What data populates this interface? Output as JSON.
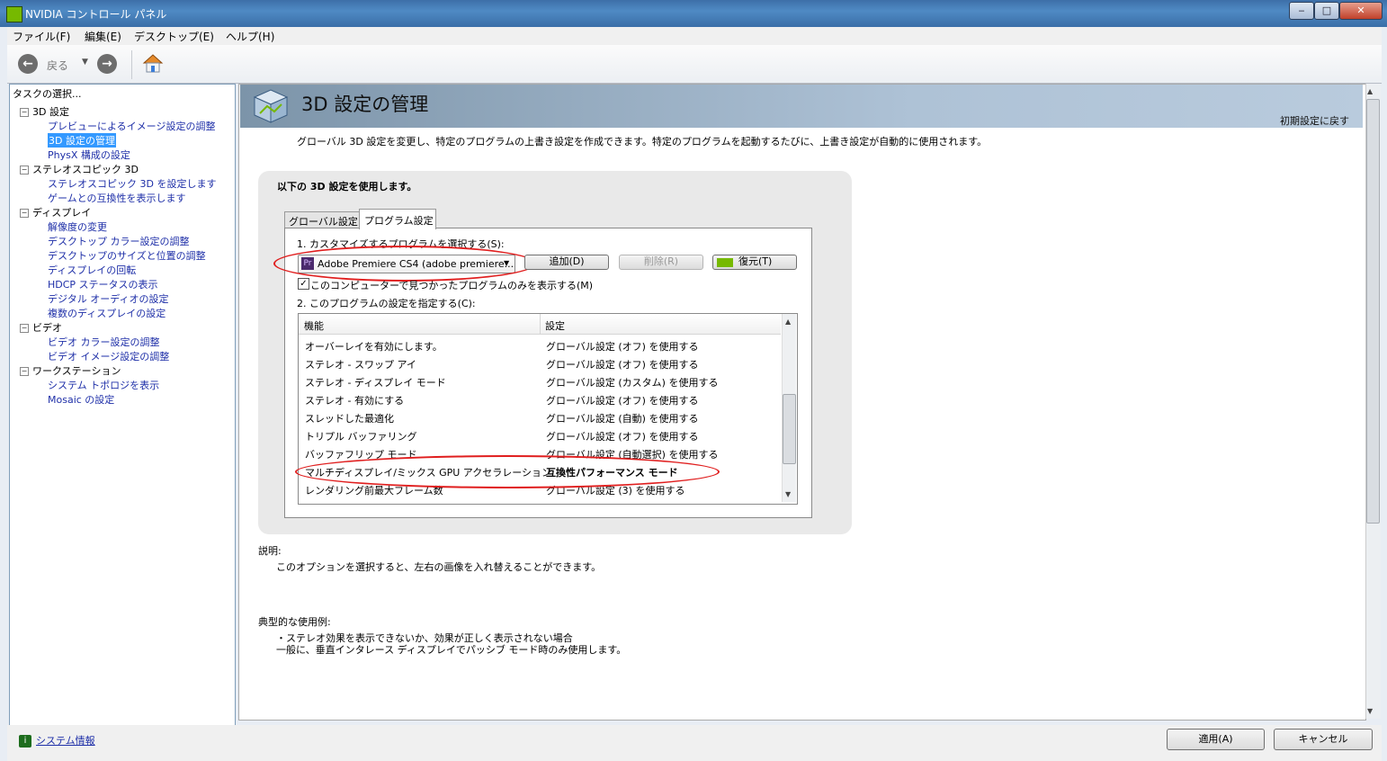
{
  "window": {
    "title": "NVIDIA コントロール パネル",
    "minimize": "‒",
    "maximize": "□",
    "close": "✕"
  },
  "menu": [
    "ファイル(F)",
    "編集(E)",
    "デスクトップ(E)",
    "ヘルプ(H)"
  ],
  "toolbar": {
    "back_label": "戻る"
  },
  "task_panel": {
    "title": "タスクの選択...",
    "tree": [
      {
        "label": "3D 設定",
        "children": [
          "プレビューによるイメージ設定の調整",
          "3D 設定の管理",
          "PhysX 構成の設定"
        ]
      },
      {
        "label": "ステレオスコピック 3D",
        "children": [
          "ステレオスコピック 3D を設定します",
          "ゲームとの互換性を表示します"
        ]
      },
      {
        "label": "ディスプレイ",
        "children": [
          "解像度の変更",
          "デスクトップ カラー設定の調整",
          "デスクトップのサイズと位置の調整",
          "ディスプレイの回転",
          "HDCP ステータスの表示",
          "デジタル オーディオの設定",
          "複数のディスプレイの設定"
        ]
      },
      {
        "label": "ビデオ",
        "children": [
          "ビデオ カラー設定の調整",
          "ビデオ イメージ設定の調整"
        ]
      },
      {
        "label": "ワークステーション",
        "children": [
          "システム トポロジを表示",
          "Mosaic の設定"
        ]
      }
    ],
    "selected": "3D 設定の管理"
  },
  "page": {
    "title": "3D 設定の管理",
    "restore_defaults": "初期設定に戻す",
    "intro": "グローバル 3D 設定を変更し、特定のプログラムの上書き設定を作成できます。特定のプログラムを起動するたびに、上書き設定が自動的に使用されます。",
    "group_title": "以下の 3D 設定を使用します。",
    "tabs": [
      "グローバル設定",
      "プログラム設定"
    ],
    "active_tab": "プログラム設定",
    "step1": "1. カスタマイズするプログラムを選択する(S):",
    "program_select": "Adobe Premiere CS4 (adobe premiere...",
    "program_icon": "Pr",
    "btn_add": "追加(D)",
    "btn_remove": "削除(R)",
    "btn_restore": "復元(T)",
    "checkbox_label": "このコンピューターで見つかったプログラムのみを表示する(M)",
    "checkbox_checked": true,
    "step2": "2. このプログラムの設定を指定する(C):",
    "grid_headers": [
      "機能",
      "設定"
    ],
    "grid_rows": [
      [
        "オーバーレイを有効にします。",
        "グローバル設定 (オフ) を使用する"
      ],
      [
        "ステレオ - スワップ アイ",
        "グローバル設定 (オフ) を使用する"
      ],
      [
        "ステレオ - ディスプレイ モード",
        "グローバル設定 (カスタム) を使用する"
      ],
      [
        "ステレオ - 有効にする",
        "グローバル設定 (オフ) を使用する"
      ],
      [
        "スレッドした最適化",
        "グローバル設定 (自動) を使用する"
      ],
      [
        "トリプル バッファリング",
        "グローバル設定 (オフ) を使用する"
      ],
      [
        "バッファフリップ モード",
        "グローバル設定 (自動選択) を使用する"
      ],
      [
        "マルチディスプレイ/ミックス GPU アクセラレーション",
        "互換性パフォーマンス モード"
      ],
      [
        "レンダリング前最大フレーム数",
        "グローバル設定 (3) を使用する"
      ]
    ],
    "description_title": "説明:",
    "description_text": "このオプションを選択すると、左右の画像を入れ替えることができます。",
    "usage_title": "典型的な使用例:",
    "usage_lines": [
      "・ステレオ効果を表示できないか、効果が正しく表示されない場合",
      "一般に、垂直インタレース ディスプレイでパッシブ モード時のみ使用します。"
    ]
  },
  "footer": {
    "system_info": "システム情報",
    "apply": "適用(A)",
    "cancel": "キャンセル"
  },
  "colors": {
    "accent_link": "#1e2fa8",
    "selection": "#3399ff",
    "highlight_ellipse": "#e01e1e",
    "nvidia_green": "#76b900"
  }
}
